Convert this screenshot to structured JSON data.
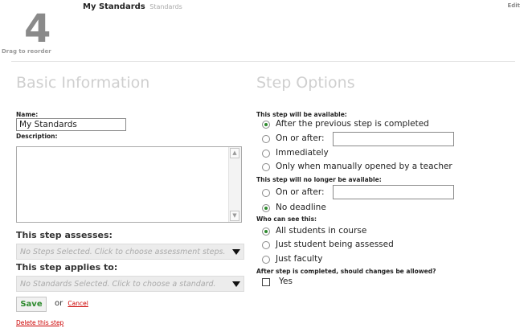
{
  "header": {
    "step_number": "4",
    "drag_label": "Drag to reorder",
    "title": "My Standards",
    "subtitle": "Standards",
    "edit_label": "Edit"
  },
  "basic_info": {
    "heading": "Basic Information",
    "name_label": "Name:",
    "name_value": "My Standards",
    "description_label": "Description:",
    "description_value": "",
    "assesses_label": "This step assesses:",
    "assesses_placeholder": "No Steps Selected. Click to choose assessment steps.",
    "applies_label": "This step applies to:",
    "applies_placeholder": "No Standards Selected. Click to choose a standard.",
    "save_label": "Save",
    "or_label": "or",
    "cancel_label": "Cancel",
    "delete_label": "Delete this step"
  },
  "step_options": {
    "heading": "Step Options",
    "available_label": "This step will be available:",
    "available_options": [
      "After the previous step is completed",
      "On or after:",
      "Immediately",
      "Only when manually opened by a teacher"
    ],
    "available_selected": 0,
    "available_date": "",
    "unavailable_label": "This step will no longer be available:",
    "unavailable_options": [
      "On or after:",
      "No deadline"
    ],
    "unavailable_selected": 1,
    "unavailable_date": "",
    "visibility_label": "Who can see this:",
    "visibility_options": [
      "All students in course",
      "Just student being assessed",
      "Just faculty"
    ],
    "visibility_selected": 0,
    "changes_label": "After step is completed, should changes be allowed?",
    "changes_option": "Yes",
    "changes_checked": false
  },
  "colors": {
    "accent_green": "#2d8a2d",
    "link_red": "#cc0000",
    "heading_grey": "#cfcfcf"
  }
}
